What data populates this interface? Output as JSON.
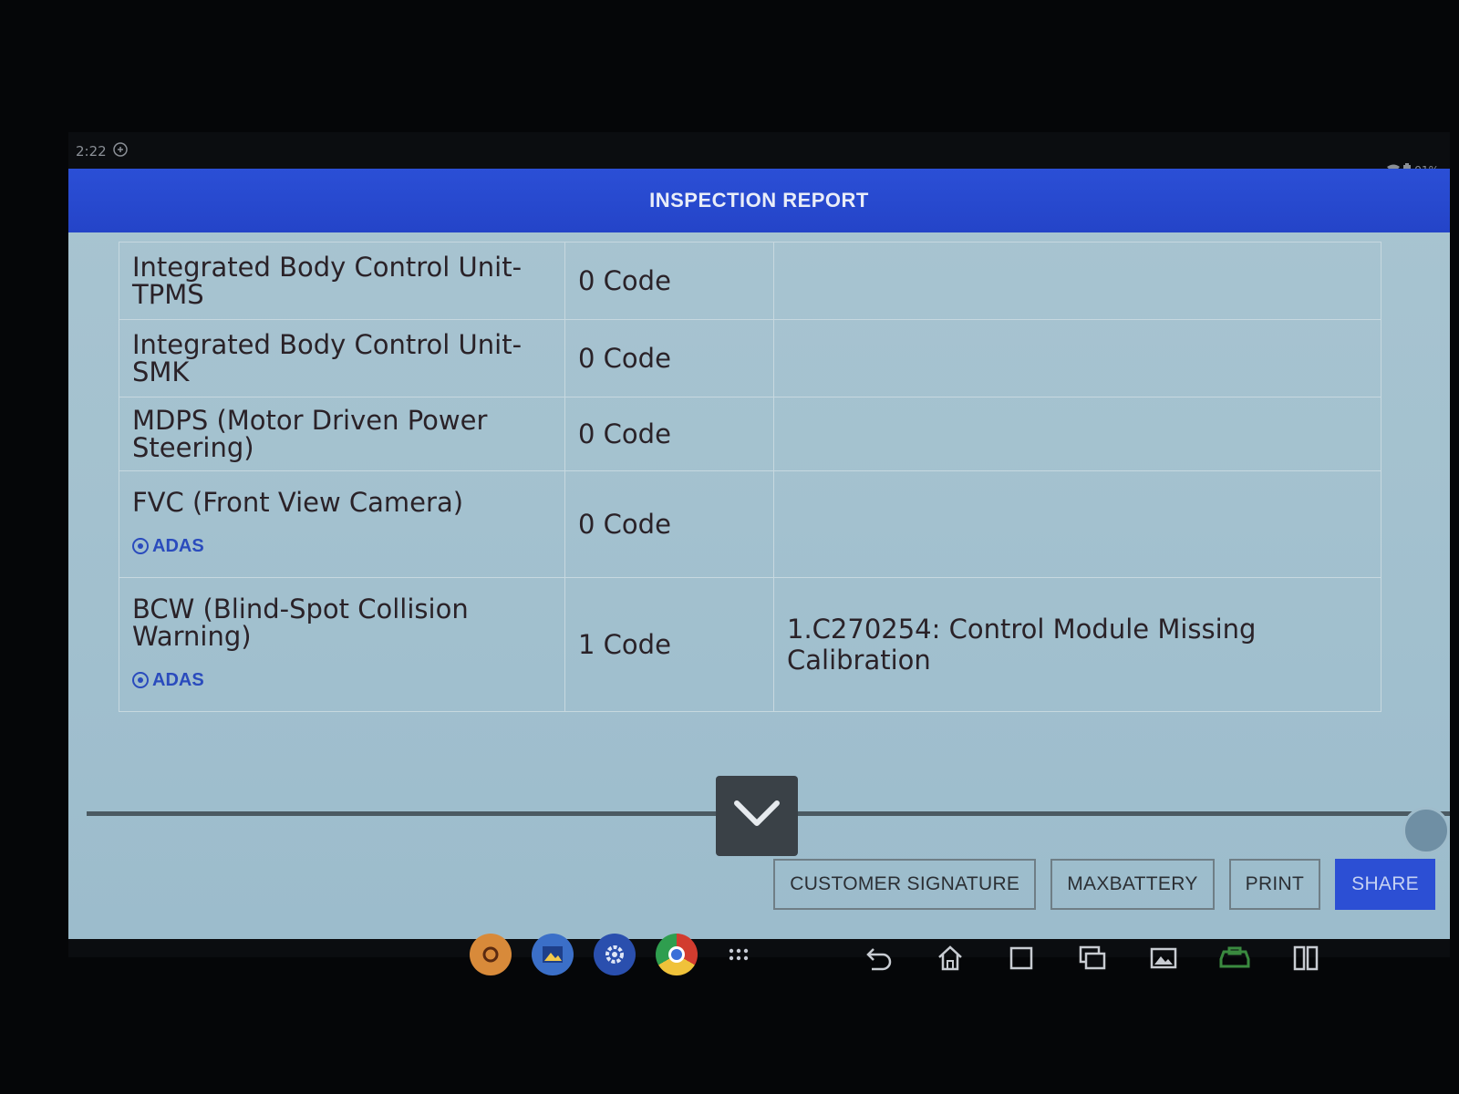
{
  "status": {
    "time": "2:22",
    "battery": "91%"
  },
  "header": {
    "title": "INSPECTION REPORT"
  },
  "rows": [
    {
      "module": "Integrated Body Control Unit-TPMS",
      "count": "0 Code",
      "desc": "",
      "tag": ""
    },
    {
      "module": "Integrated Body Control Unit-SMK",
      "count": "0 Code",
      "desc": "",
      "tag": ""
    },
    {
      "module": "MDPS (Motor Driven Power Steering)",
      "count": "0 Code",
      "desc": "",
      "tag": ""
    },
    {
      "module": "FVC (Front View Camera)",
      "count": "0 Code",
      "desc": "",
      "tag": "ADAS"
    },
    {
      "module": "BCW (Blind-Spot Collision Warning)",
      "count": "1 Code",
      "desc": "1.C270254: Control Module Missing Calibration",
      "tag": "ADAS"
    }
  ],
  "actions": {
    "customer_signature": "CUSTOMER SIGNATURE",
    "maxbattery": "MAXBATTERY",
    "print": "PRINT",
    "share": "SHARE"
  },
  "colors": {
    "header": "#2444c8",
    "content": "#a3c1cf",
    "accent": "#2c4fd4"
  },
  "icons": {
    "scroll": "chevron-down-icon",
    "dock": [
      "camera-app-icon",
      "gallery-app-icon",
      "settings-icon",
      "chrome-icon",
      "app-drawer-icon"
    ],
    "nav": [
      "back-icon",
      "home-icon",
      "stop-icon",
      "recent-apps-icon",
      "screenshot-icon",
      "vci-icon",
      "split-screen-icon"
    ]
  }
}
